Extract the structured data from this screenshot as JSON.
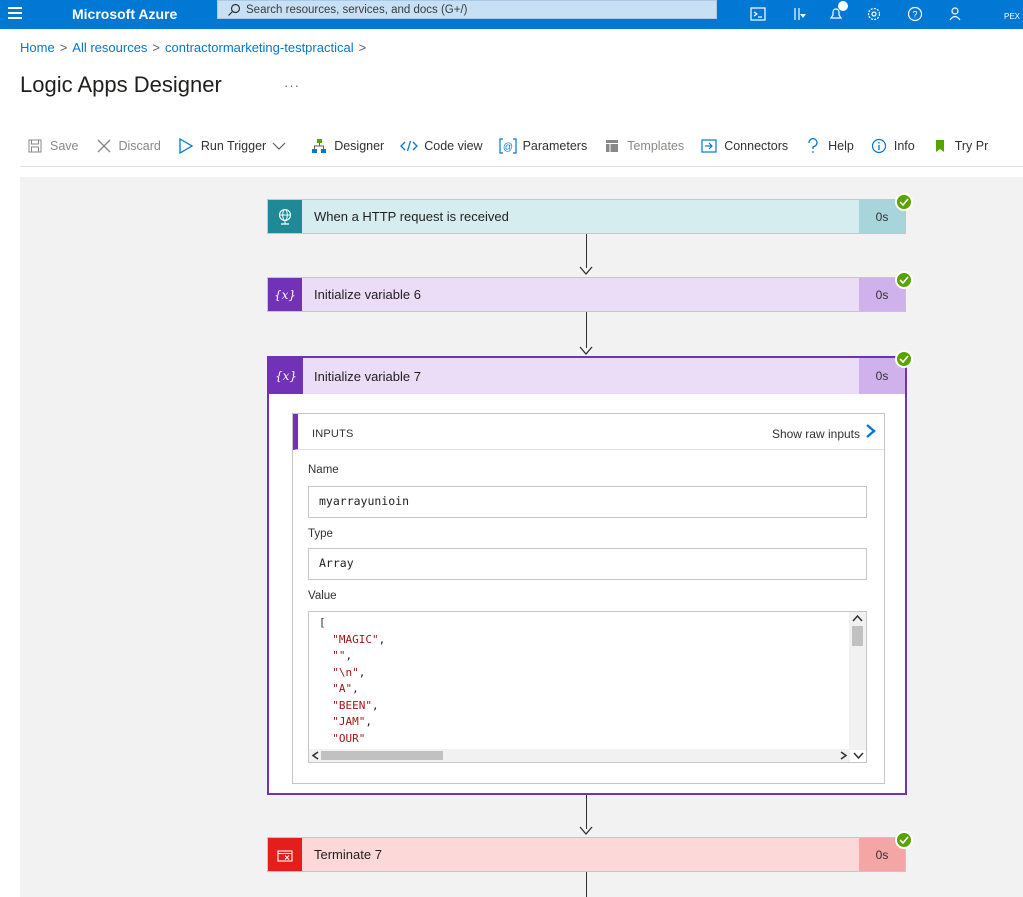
{
  "topbar": {
    "brand": "Microsoft Azure",
    "search_placeholder": "Search resources, services, and docs (G+/)",
    "account_label": "PEX",
    "accent": "#0078d4",
    "icons": [
      "cloud-shell-icon",
      "directory-filter-icon",
      "notifications-icon",
      "settings-icon",
      "help-icon",
      "feedback-icon"
    ]
  },
  "breadcrumb": {
    "items": [
      "Home",
      "All resources",
      "contractormarketing-testpractical"
    ],
    "separator": ">"
  },
  "page": {
    "title": "Logic Apps Designer",
    "more": "···"
  },
  "toolbar": {
    "save": "Save",
    "discard": "Discard",
    "run_trigger": "Run Trigger",
    "designer": "Designer",
    "code_view": "Code view",
    "parameters": "Parameters",
    "templates": "Templates",
    "connectors": "Connectors",
    "help": "Help",
    "info": "Info",
    "try_preview": "Try Pr"
  },
  "workflow": {
    "steps": [
      {
        "title": "When a HTTP request is received",
        "duration": "0s",
        "status": "succeeded",
        "color": "#1f8a96"
      },
      {
        "title": "Initialize variable 6",
        "duration": "0s",
        "status": "succeeded",
        "color": "#7232b8"
      },
      {
        "title": "Initialize variable 7",
        "duration": "0s",
        "status": "succeeded",
        "color": "#7232b8"
      },
      {
        "title": "Terminate 7",
        "duration": "0s",
        "status": "succeeded",
        "color": "#e41d1d"
      }
    ],
    "expanded": {
      "inputs_label": "INPUTS",
      "show_raw": "Show raw inputs",
      "name_label": "Name",
      "name_value": "myarrayunioin",
      "type_label": "Type",
      "type_value": "Array",
      "value_label": "Value",
      "value_lines": [
        "[",
        "  \"MAGIC\",",
        "  \"\",",
        "  \"\\n\",",
        "  \"A\",",
        "  \"BEEN\",",
        "  \"JAM\",",
        "  \"OUR\""
      ]
    }
  }
}
